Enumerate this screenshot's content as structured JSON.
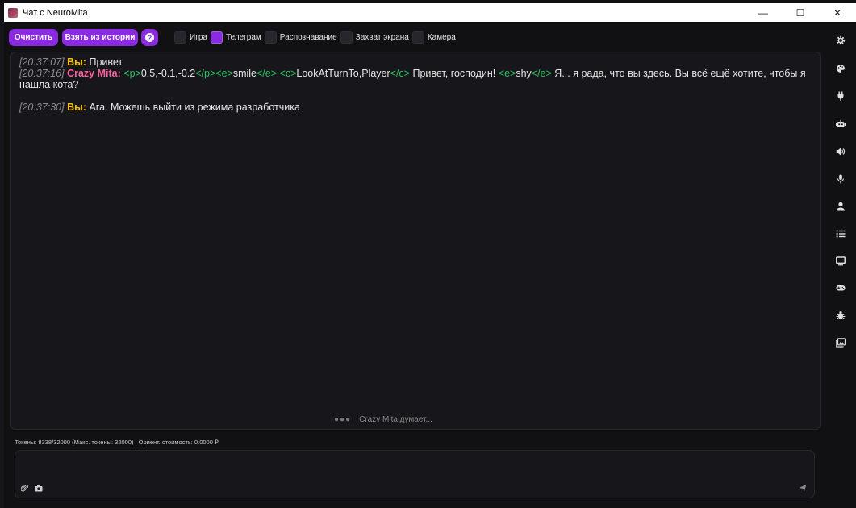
{
  "window": {
    "title": "Чат с NeuroMita",
    "minimize": "—",
    "maximize": "☐",
    "close": "✕"
  },
  "toolbar": {
    "clear_label": "Очистить",
    "history_label": "Взять из истории",
    "help_label": "?",
    "checkboxes": [
      {
        "label": "Игра",
        "checked": false
      },
      {
        "label": "Телеграм",
        "checked": true
      },
      {
        "label": "Распознавание",
        "checked": false
      },
      {
        "label": "Захват экрана",
        "checked": false
      },
      {
        "label": "Камера",
        "checked": false
      }
    ]
  },
  "messages": [
    {
      "time": "[20:37:07]",
      "speaker": "Вы:",
      "text": "Привет"
    },
    {
      "time": "[20:37:16]",
      "speaker": "Crazy Mita:",
      "parts": [
        {
          "t": "tag",
          "v": "<p>"
        },
        {
          "t": "txt",
          "v": "0.5,-0.1,-0.2"
        },
        {
          "t": "tag",
          "v": "</p>"
        },
        {
          "t": "tag",
          "v": "<e>"
        },
        {
          "t": "txt",
          "v": "smile"
        },
        {
          "t": "tag",
          "v": "</e>"
        },
        {
          "t": "tag",
          "v": "<c>"
        },
        {
          "t": "txt",
          "v": "LookAtTurnTo,Player"
        },
        {
          "t": "tag",
          "v": "</c>"
        },
        {
          "t": "txt",
          "v": "Привет, господин!"
        },
        {
          "t": "tag",
          "v": "<e>"
        },
        {
          "t": "txt",
          "v": "shy"
        },
        {
          "t": "tag",
          "v": "</e>"
        },
        {
          "t": "txt",
          "v": "Я... я рада, что вы здесь. Вы всё ещё хотите, чтобы я нашла кота?"
        }
      ]
    },
    {
      "time": "[20:37:30]",
      "speaker": "Вы:",
      "text": "Ага. Можешь выйти из режима разработчика"
    }
  ],
  "status": {
    "thinking": "Crazy Mita думает..."
  },
  "tokens": "Токены: 8338/32000 (Макс. токены: 32000) | Ориент. стоимость: 0.0000 ₽",
  "colors": {
    "accent": "#8a2be2",
    "you": "#f7c400",
    "mita": "#ff5f9e",
    "tag": "#22c55e"
  },
  "sidebar_icons": [
    "gear-icon",
    "palette-icon",
    "plug-icon",
    "robot-icon",
    "speaker-icon",
    "microphone-icon",
    "user-icon",
    "list-icon",
    "monitor-icon",
    "gamepad-icon",
    "bug-icon",
    "image-icon"
  ]
}
